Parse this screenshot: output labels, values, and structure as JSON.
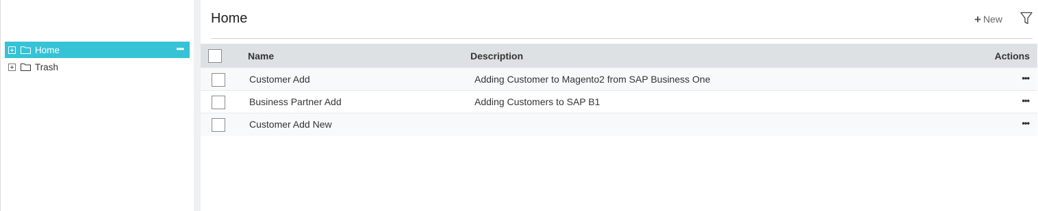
{
  "sidebar": {
    "items": [
      {
        "label": "Home",
        "more": "•••"
      },
      {
        "label": "Trash"
      }
    ]
  },
  "header": {
    "title": "Home",
    "new_label": "New",
    "new_icon": "plus-icon",
    "filter_icon": "filter-icon"
  },
  "table": {
    "columns": [
      "Name",
      "Description",
      "Actions"
    ],
    "rows": [
      {
        "name": "Customer Add",
        "description": "Adding Customer to Magento2 from SAP Business One",
        "actions": "•••"
      },
      {
        "name": "Business Partner Add",
        "description": "Adding Customers to SAP B1",
        "actions": "•••"
      },
      {
        "name": "Customer Add New",
        "description": "",
        "actions": "•••"
      }
    ]
  },
  "colors": {
    "accent": "#35c3d5",
    "header_bg": "#dde1e3"
  }
}
